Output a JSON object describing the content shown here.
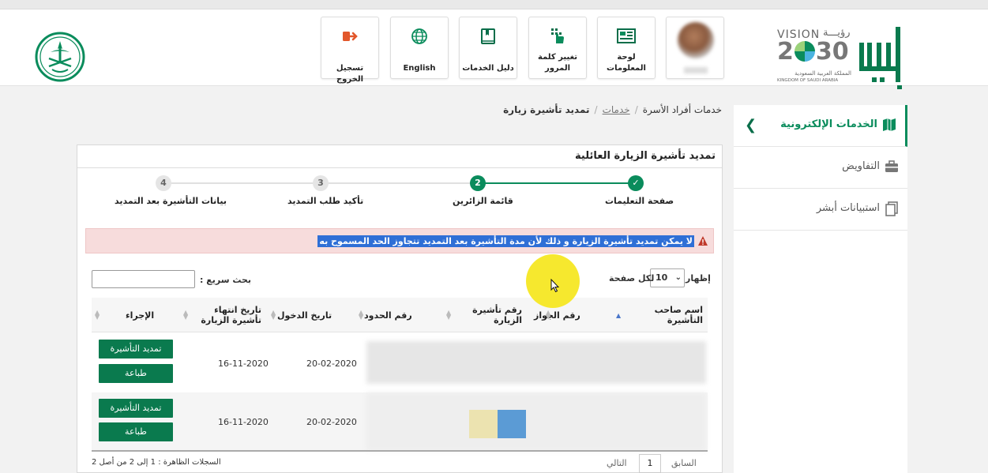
{
  "header": {
    "nav": [
      {
        "key": "info",
        "label": "لوحة المعلومات",
        "icon": "dashboard-icon"
      },
      {
        "key": "password",
        "label": "تغيير كلمة المرور",
        "icon": "keypad-hand-icon"
      },
      {
        "key": "guide",
        "label": "دليل الخدمات",
        "icon": "book-icon"
      },
      {
        "key": "lang",
        "label": "English",
        "icon": "globe-icon"
      },
      {
        "key": "logout",
        "label": "تسجيل الخروج",
        "icon": "logout-icon"
      }
    ],
    "vision_text": "VISION",
    "vision_arabic": "رؤيـــة",
    "vision_year_a": "2",
    "vision_year_b": "30",
    "vision_kingdom_ar": "المملكة العربية السعودية",
    "vision_kingdom_en": "KINGDOM OF SAUDI ARABIA",
    "absher_logo": "أبشر",
    "colors": {
      "brand": "#0a8c5c",
      "logout": "#e2572b"
    }
  },
  "sidebar": {
    "items": [
      {
        "label": "الخدمات الإلكترونية",
        "icon": "eservices-icon",
        "active": true
      },
      {
        "label": "التفاويض",
        "icon": "briefcase-icon",
        "active": false
      },
      {
        "label": "استبيانات أبشر",
        "icon": "survey-icon",
        "active": false
      }
    ]
  },
  "breadcrumb": {
    "items": [
      "خدمات أفراد الأسرة",
      "خدمات",
      "تمديد تأشيرة زيارة"
    ]
  },
  "panel": {
    "title": "تمديد تأشيرة الزيارة العائلية",
    "steps": [
      {
        "num": "✓",
        "label": "صفحة التعليمات",
        "done": true
      },
      {
        "num": "2",
        "label": "قائمة الزائرين",
        "done": true
      },
      {
        "num": "3",
        "label": "تأكيد طلب التمديد",
        "done": false
      },
      {
        "num": "4",
        "label": "بيانات التأشيرة بعد التمديد",
        "done": false
      }
    ],
    "alert": "لا يمكن تمديد تأشيرة الزيارة و ذلك لأن مدة التأشيرة بعد التمديد تتجاوز الحد المسموح به",
    "show_label": "إظهار",
    "per_page_label": "لكل صفحة",
    "per_page_value": "10",
    "quick_search_label": "بحث سريع :",
    "columns": [
      "اسم صاحب التأشيرة",
      "رقم الجواز",
      "رقم تأشيرة الزيارة",
      "رقم الحدود",
      "تاريخ الدخول",
      "تاريخ انتهاء تأشيرة الزيارة",
      "الإجراء"
    ],
    "rows": [
      {
        "entry_date": "20-02-2020",
        "expiry_date": "16-11-2020",
        "extend_label": "تمديد التأشيرة",
        "print_label": "طباعة"
      },
      {
        "entry_date": "20-02-2020",
        "expiry_date": "16-11-2020",
        "extend_label": "تمديد التأشيرة",
        "print_label": "طباعة"
      }
    ],
    "records_info": "السجلات الظاهرة : 1 إلى 2 من أصل 2",
    "pager": {
      "prev": "السابق",
      "page": "1",
      "next": "التالي"
    }
  }
}
